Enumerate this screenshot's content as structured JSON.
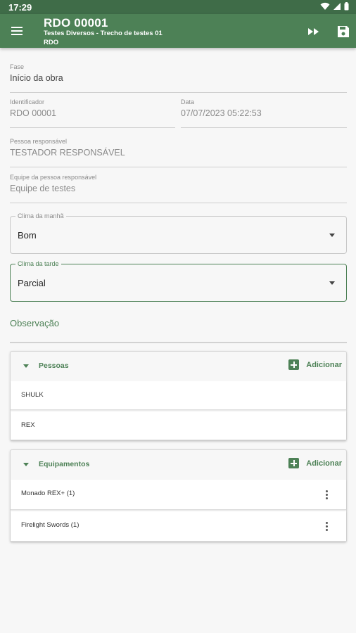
{
  "status_bar": {
    "time": "17:29"
  },
  "app_bar": {
    "title": "RDO 00001",
    "subtitle": "Testes Diversos - Trecho de testes 01",
    "subtitle2": "RDO"
  },
  "form": {
    "fase": {
      "label": "Fase",
      "value": "Início da obra"
    },
    "identificador": {
      "label": "Identificador",
      "value": "RDO 00001"
    },
    "data": {
      "label": "Data",
      "value": "07/07/2023 05:22:53"
    },
    "pessoa_responsavel": {
      "label": "Pessoa responsável",
      "value": "TESTADOR RESPONSÁVEL"
    },
    "equipe": {
      "label": "Equipe da pessoa responsável",
      "value": "Equipe de testes"
    },
    "clima_manha": {
      "label": "Clima da manhã",
      "value": "Bom"
    },
    "clima_tarde": {
      "label": "Clima da tarde",
      "value": "Parcial"
    },
    "observacao": {
      "placeholder": "Observação"
    }
  },
  "pessoas": {
    "title": "Pessoas",
    "add_label": "Adicionar",
    "items": [
      "SHULK",
      "REX"
    ]
  },
  "equipamentos": {
    "title": "Equipamentos",
    "add_label": "Adicionar",
    "items": [
      "Monado REX+ (1)",
      "Firelight Swords (1)"
    ]
  },
  "colors": {
    "primary": "#4d8156",
    "status_bar": "#3f6c48"
  },
  "icons": [
    "menu-icon",
    "fast-forward-icon",
    "save-icon",
    "chevron-down-icon",
    "add-box-icon",
    "more-vert-icon"
  ]
}
